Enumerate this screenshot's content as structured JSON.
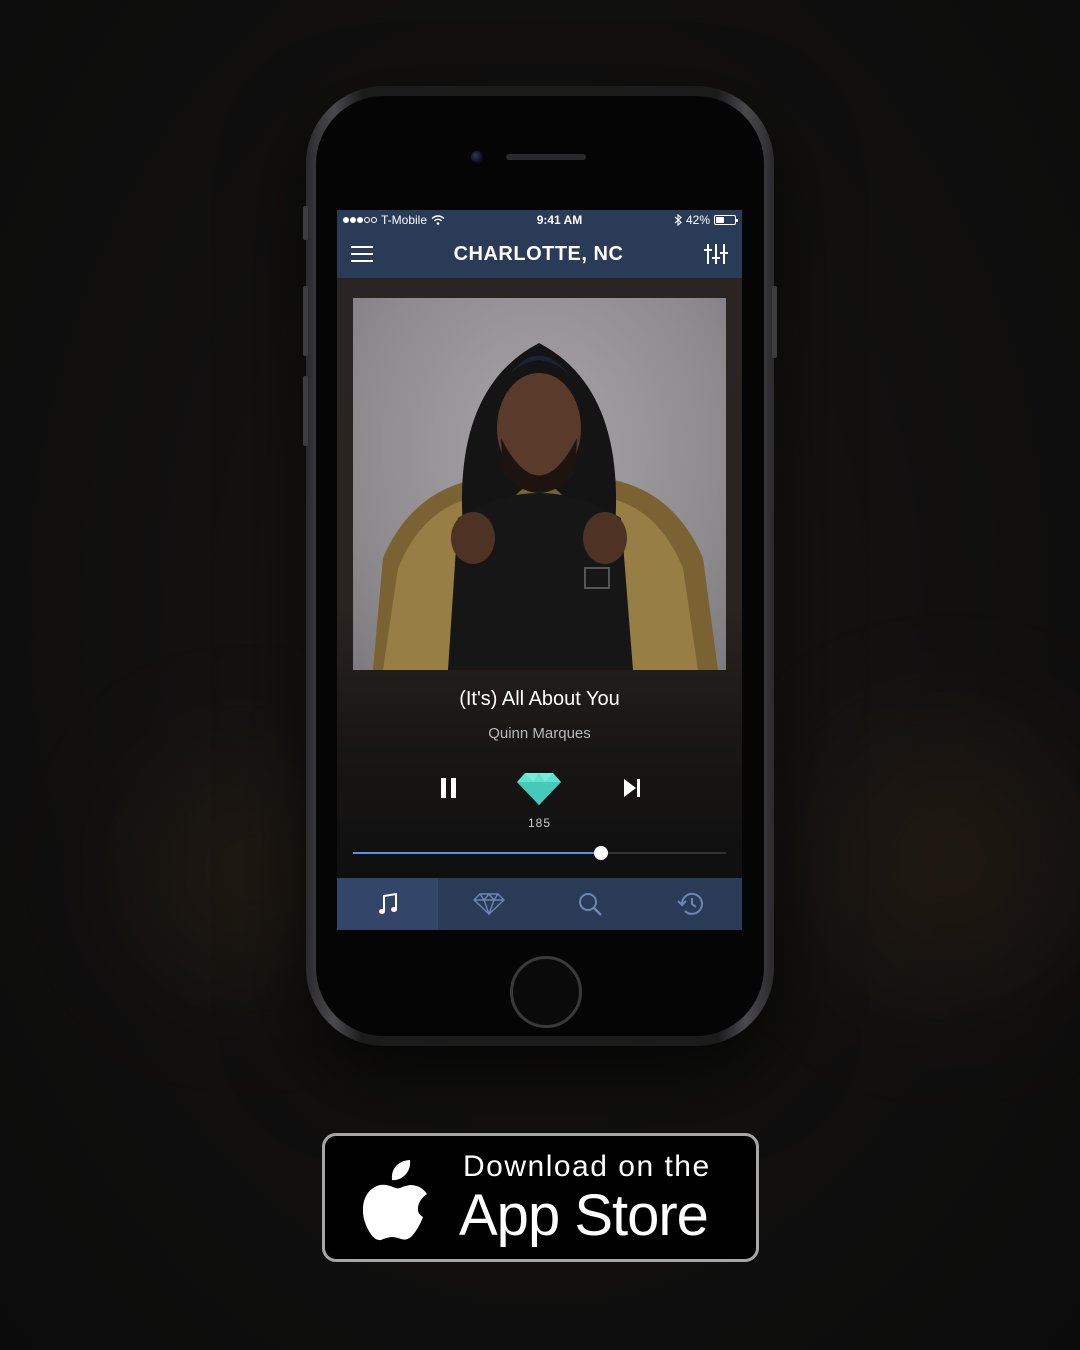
{
  "status_bar": {
    "carrier": "T-Mobile",
    "time": "9:41 AM",
    "battery": "42%",
    "battery_level": 0.42,
    "icons": [
      "signal-dots-icon",
      "wifi-icon",
      "bluetooth-icon",
      "battery-icon"
    ]
  },
  "nav": {
    "title": "CHARLOTTE, NC",
    "left_icon": "hamburger-menu-icon",
    "right_icon": "equalizer-sliders-icon"
  },
  "player": {
    "song_title": "(It's) All About You",
    "artist": "Quinn Marques",
    "diamond_count": "185",
    "progress": 0.665,
    "controls": [
      "pause-icon",
      "diamond-icon",
      "skip-next-icon"
    ],
    "accent_color": "#5b8fe0",
    "diamond_color": "#5ee3d0"
  },
  "tabs": [
    {
      "icon": "music-note-icon",
      "active": true
    },
    {
      "icon": "diamond-outline-icon",
      "active": false
    },
    {
      "icon": "search-icon",
      "active": false
    },
    {
      "icon": "history-clock-icon",
      "active": false
    }
  ],
  "badge": {
    "line1": "Download on the",
    "line2": "App Store",
    "icon": "apple-logo-icon"
  },
  "colors": {
    "bar": "#2a3b57",
    "tab_active": "#33466a"
  }
}
